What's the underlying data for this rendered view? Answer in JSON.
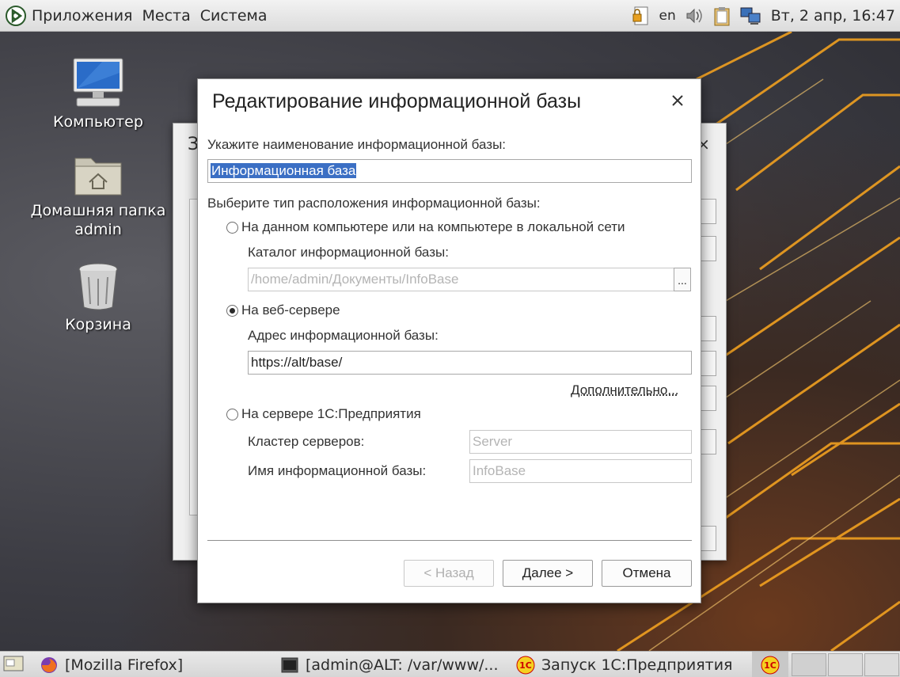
{
  "top_panel": {
    "menu": [
      "Приложения",
      "Места",
      "Система"
    ],
    "lang": "en",
    "clock": "Вт,  2 апр, 16:47"
  },
  "desktop": {
    "icons": [
      {
        "label": "Компьютер",
        "icon": "computer-icon"
      },
      {
        "label": "Домашняя папка admin",
        "icon": "home-folder-icon"
      },
      {
        "label": "Корзина",
        "icon": "trash-icon"
      }
    ]
  },
  "background_window": {
    "title_partial": "З",
    "close": "×"
  },
  "dialog": {
    "title": "Редактирование информационной базы",
    "close_icon": "close-icon",
    "name_label": "Укажите наименование информационной базы:",
    "name_value": "Информационная база",
    "location_label": "Выберите тип расположения информационной базы:",
    "options": {
      "local": {
        "label": "На данном компьютере или на компьютере в локальной сети",
        "checked": false,
        "catalog_label": "Каталог информационной базы:",
        "catalog_value": "/home/admin/Документы/InfoBase",
        "browse_label": "..."
      },
      "web": {
        "label": "На веб-сервере",
        "checked": true,
        "address_label": "Адрес информационной базы:",
        "address_value": "https://alt/base/",
        "more_link": "Дополнительно..."
      },
      "server": {
        "label": "На сервере 1С:Предприятия",
        "checked": false,
        "cluster_label": "Кластер серверов:",
        "cluster_placeholder": "Server",
        "ib_name_label": "Имя информационной базы:",
        "ib_name_placeholder": "InfoBase"
      }
    },
    "buttons": {
      "back": "< Назад",
      "next": "Далее >",
      "cancel": "Отмена"
    }
  },
  "taskbar": {
    "tasks": [
      {
        "label": "[Mozilla Firefox]",
        "icon": "firefox-icon"
      },
      {
        "label": "[admin@ALT: /var/www/...",
        "icon": "terminal-icon"
      },
      {
        "label": "Запуск 1С:Предприятия",
        "icon": "1c-icon"
      }
    ]
  }
}
